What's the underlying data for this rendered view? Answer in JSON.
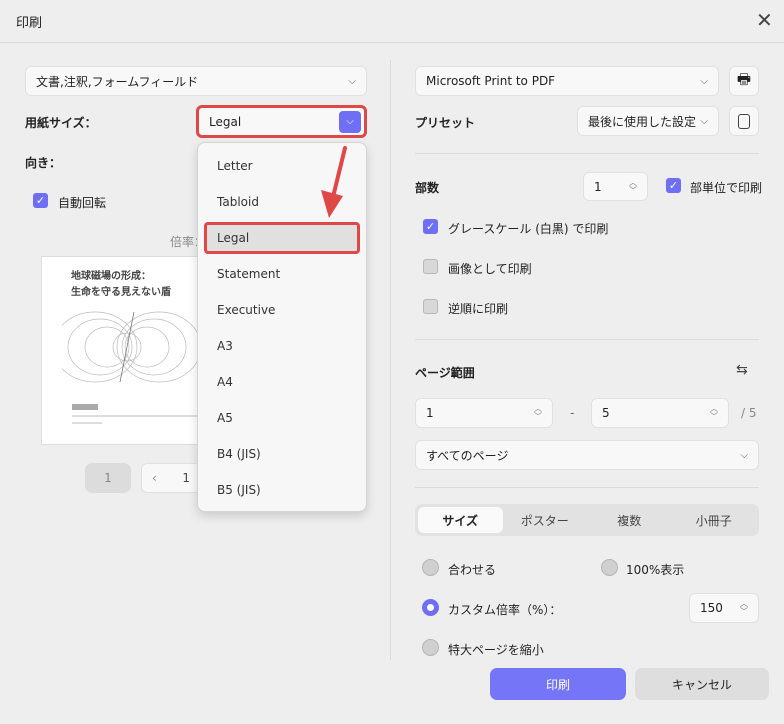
{
  "dialog": {
    "title": "印刷"
  },
  "left": {
    "content_select": "文書,注釈,フォームフィールド",
    "paper_size_label": "用紙サイズ：",
    "paper_size_value": "Legal",
    "orientation_label": "向き：",
    "auto_rotate_label": "自動回転",
    "auto_rotate_checked": true,
    "scale_label": "倍率：",
    "preview": {
      "title_line1": "地球磁場の形成：",
      "title_line2": "生命を守る見えない盾"
    },
    "page_input": "1",
    "page_nav_current": "1"
  },
  "paper_menu": {
    "items": [
      "Letter",
      "Tabloid",
      "Legal",
      "Statement",
      "Executive",
      "A3",
      "A4",
      "A5",
      "B4 (JIS)",
      "B5 (JIS)"
    ],
    "selected": "Legal"
  },
  "right": {
    "printer": "Microsoft Print to PDF",
    "preset_label": "プリセット",
    "preset_value": "最後に使用した設定",
    "copies_label": "部数",
    "copies_value": "1",
    "collate_label": "部単位で印刷",
    "options": [
      {
        "label": "グレースケール (白黒) で印刷",
        "checked": true
      },
      {
        "label": "画像として印刷",
        "checked": false
      },
      {
        "label": "逆順に印刷",
        "checked": false
      }
    ],
    "page_range_label": "ページ範囲",
    "range_from": "1",
    "range_sep": "-",
    "range_to": "5",
    "range_total": "/ 5",
    "range_select": "すべてのページ",
    "tabs": [
      "サイズ",
      "ポスター",
      "複数",
      "小冊子"
    ],
    "active_tab": "サイズ",
    "radios": {
      "fit": "合わせる",
      "actual": "100%表示",
      "custom": "カスタム倍率（%）：",
      "shrink": "特大ページを縮小"
    },
    "selected_radio": "custom",
    "custom_scale": "150",
    "print_button": "印刷",
    "cancel_button": "キャンセル"
  },
  "colors": {
    "accent": "#6f6ff5",
    "highlight": "#e04848"
  }
}
